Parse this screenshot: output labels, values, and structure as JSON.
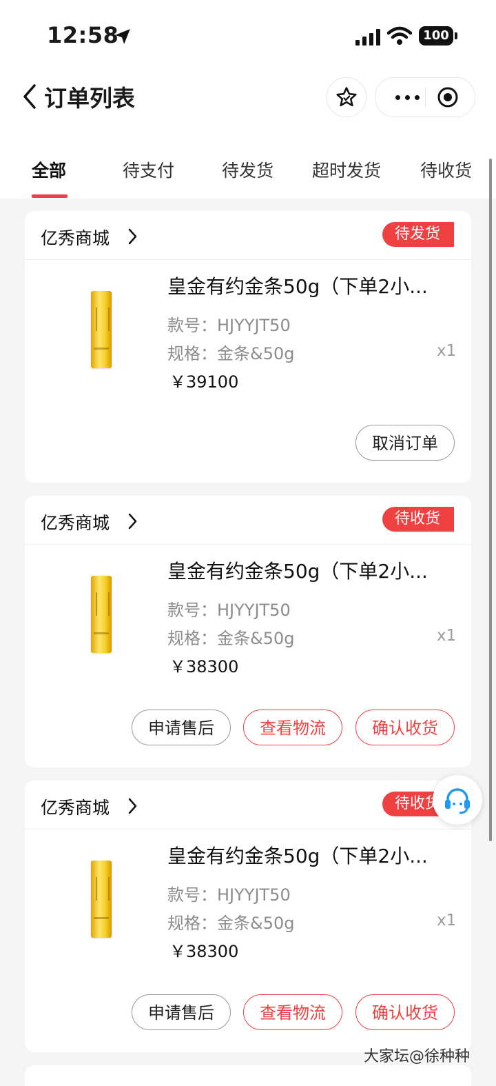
{
  "status_bar": {
    "time": "12:58",
    "battery": "100"
  },
  "nav": {
    "title": "订单列表"
  },
  "tabs": [
    "全部",
    "待支付",
    "待发货",
    "超时发货",
    "待收货"
  ],
  "orders": [
    {
      "shop": "亿秀商城",
      "status": "待发货",
      "title": "皇金有约金条50g（下单2小...",
      "style_label": "款号：",
      "style_value": "HJYYJT50",
      "spec_label": "规格：",
      "spec_value": "金条&50g",
      "qty": "x1",
      "price": "￥39100",
      "buttons": [
        "取消订单"
      ]
    },
    {
      "shop": "亿秀商城",
      "status": "待收货",
      "title": "皇金有约金条50g（下单2小...",
      "style_label": "款号：",
      "style_value": "HJYYJT50",
      "spec_label": "规格：",
      "spec_value": "金条&50g",
      "qty": "x1",
      "price": "￥38300",
      "buttons": [
        "申请售后",
        "查看物流",
        "确认收货"
      ]
    },
    {
      "shop": "亿秀商城",
      "status": "待收货",
      "title": "皇金有约金条50g（下单2小...",
      "style_label": "款号：",
      "style_value": "HJYYJT50",
      "spec_label": "规格：",
      "spec_value": "金条&50g",
      "qty": "x1",
      "price": "￥38300",
      "buttons": [
        "申请售后",
        "查看物流",
        "确认收货"
      ]
    }
  ],
  "watermark": "大家坛@徐种种",
  "colors": {
    "accent": "#f04142",
    "background": "#f5f5f5",
    "service_icon": "#1e9bf0"
  }
}
